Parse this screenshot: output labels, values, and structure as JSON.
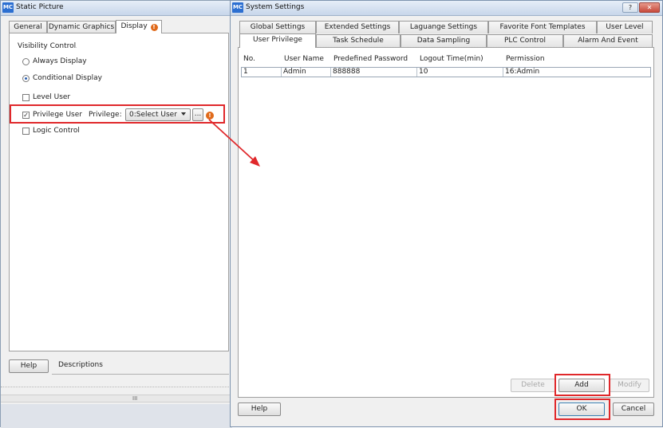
{
  "static_picture": {
    "title": "Static Picture",
    "icon_text": "MC",
    "tabs": [
      {
        "label": "General"
      },
      {
        "label": "Dynamic Graphics"
      },
      {
        "label": "Display"
      }
    ],
    "visibility_control_label": "Visibility Control",
    "always_display_label": "Always Display",
    "conditional_display_label": "Conditional Display",
    "conditional_display_selected": true,
    "level_user_label": "Level User",
    "level_user_checked": false,
    "privilege_user_label": "Privilege User",
    "privilege_user_checked": true,
    "privilege_label": "Privilege:",
    "privilege_value": "0:Select User",
    "browse_label": "...",
    "logic_control_label": "Logic Control",
    "logic_control_checked": false,
    "help_label": "Help",
    "descriptions_label": "Descriptions",
    "scroll_marker": "III"
  },
  "system_settings": {
    "title": "System Settings",
    "icon_text": "MC",
    "tabs_row1": [
      {
        "label": "Global Settings"
      },
      {
        "label": "Extended Settings"
      },
      {
        "label": "Laguange Settings"
      },
      {
        "label": "Favorite Font Templates"
      },
      {
        "label": "User Level"
      }
    ],
    "tabs_row2": [
      {
        "label": "User Privilege"
      },
      {
        "label": "Task Schedule"
      },
      {
        "label": "Data Sampling"
      },
      {
        "label": "PLC Control"
      },
      {
        "label": "Alarm And Event"
      }
    ],
    "columns": [
      "No.",
      "User Name",
      "Predefined Password",
      "Logout Time(min)",
      "Permission"
    ],
    "rows": [
      [
        "1",
        "Admin",
        "888888",
        "10",
        "16:Admin"
      ]
    ],
    "delete_label": "Delete",
    "add_label": "Add",
    "modify_label": "Modify",
    "help_label": "Help",
    "ok_label": "OK",
    "cancel_label": "Cancel",
    "help_button_text": "?",
    "close_button_text": "✕"
  },
  "colors": {
    "highlight": "#e0282b",
    "arrow": "#e0282b",
    "title_gradient_top": "#e6eef8",
    "title_gradient_bottom": "#c7d6ea"
  }
}
